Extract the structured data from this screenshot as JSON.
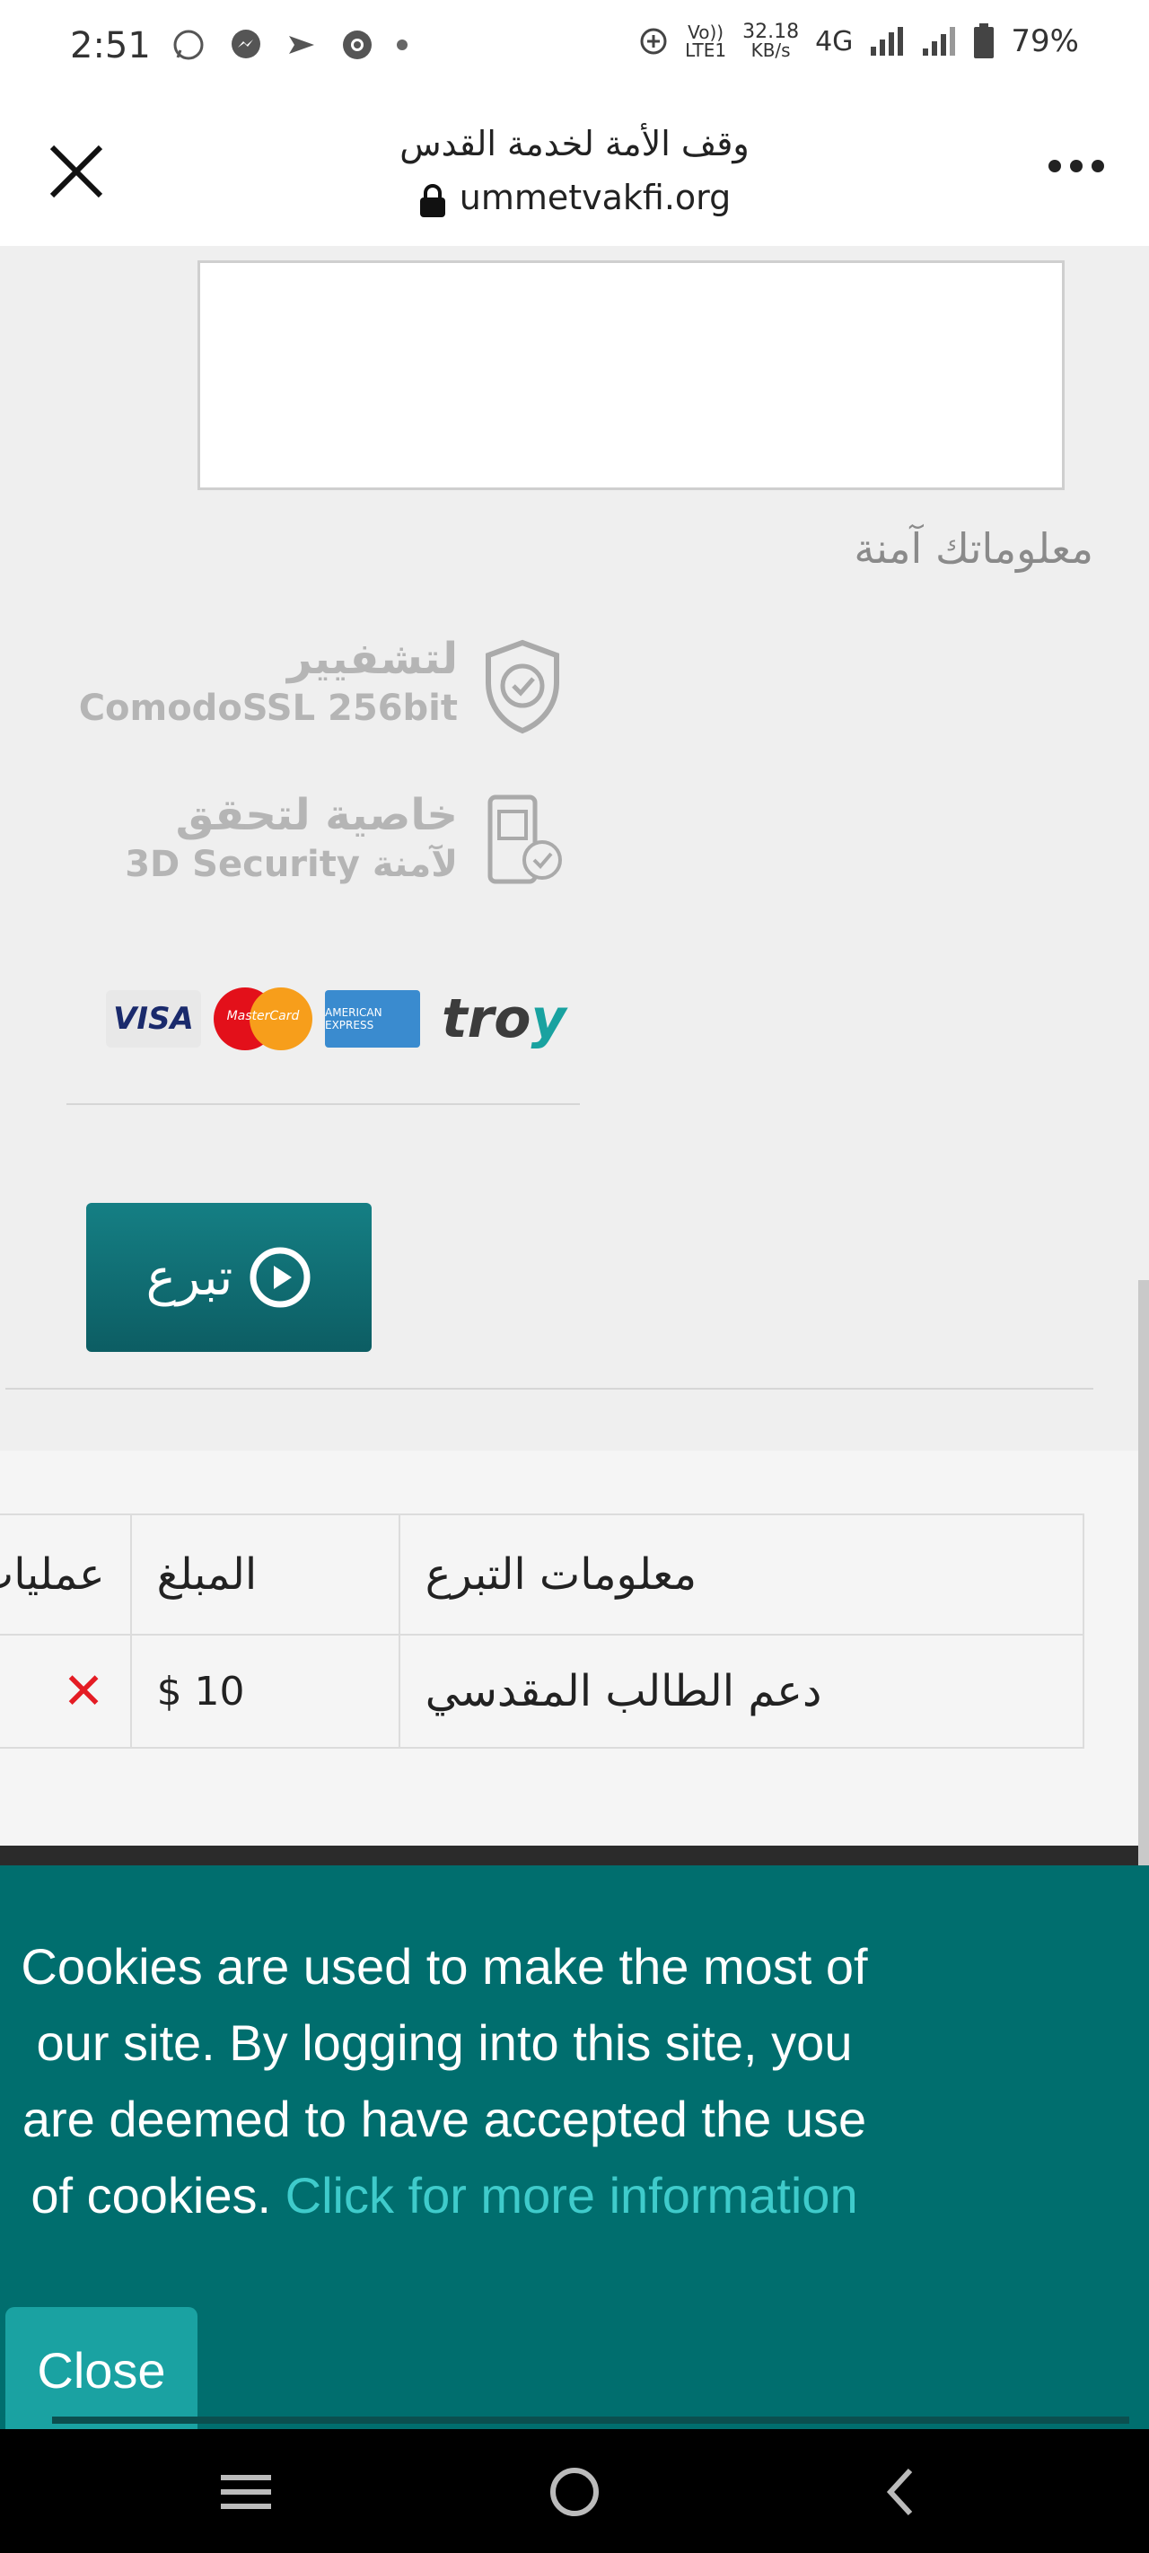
{
  "status_bar": {
    "time": "2:51",
    "network_speed_top": "32.18",
    "network_speed_bottom": "KB/s",
    "volte_top": "Vo))",
    "volte_bottom": "LTE1",
    "network_type": "4G",
    "battery": "79%"
  },
  "browser": {
    "title": "وقف الأمة لخدمة القدس",
    "url": "ummetvakfi.org"
  },
  "security": {
    "heading": "معلوماتك آمنة",
    "ssl_line1": "لتشفيير",
    "ssl_line2": "ComodoSSL 256bit",
    "secure3d_line1": "خاصية لتحقق",
    "secure3d_line2": "3D Security لآمنة"
  },
  "cards": {
    "visa": "VISA",
    "mastercard": "MasterCard",
    "amex": "AMERICAN EXPRESS",
    "troy_t": "tro",
    "troy_y": "y"
  },
  "donate_button": "تبرع",
  "donations_table": {
    "headers": {
      "info": "معلومات التبرع",
      "amount": "المبلغ",
      "operation": "عمليات"
    },
    "rows": [
      {
        "info": "دعم الطالب المقدسي",
        "amount": "$ 10",
        "operation": "✕"
      }
    ]
  },
  "cookie_banner": {
    "text": "Cookies are used to make the most of our site. By logging into this site, you are deemed to have accepted the use of cookies.",
    "link": "Click for more information",
    "close": "Close"
  }
}
